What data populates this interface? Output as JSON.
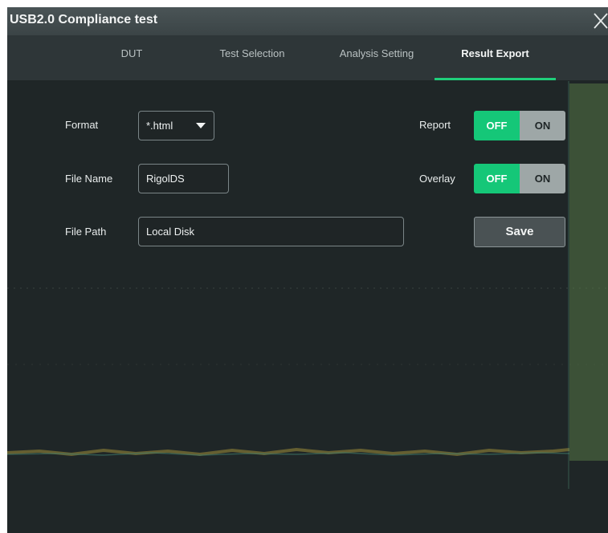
{
  "window": {
    "title": "USB2.0 Compliance test",
    "close_icon": "close-icon"
  },
  "tabs": [
    {
      "label": "DUT",
      "active": false
    },
    {
      "label": "Test Selection",
      "active": false
    },
    {
      "label": "Analysis Setting",
      "active": false
    },
    {
      "label": "Result Export",
      "active": true
    }
  ],
  "form": {
    "format": {
      "label": "Format",
      "value": "*.html"
    },
    "file_name": {
      "label": "File Name",
      "value": "RigolDS"
    },
    "file_path": {
      "label": "File Path",
      "value": "Local Disk"
    },
    "report": {
      "label": "Report",
      "off_label": "OFF",
      "on_label": "ON",
      "state": "OFF"
    },
    "overlay": {
      "label": "Overlay",
      "off_label": "OFF",
      "on_label": "ON",
      "state": "OFF"
    },
    "save_label": "Save"
  },
  "colors": {
    "accent": "#15c778",
    "tab_underline": "#1fcf7a",
    "background": "#1f2627",
    "titlebar": "#434c4e",
    "trace": "#b8a23a"
  }
}
